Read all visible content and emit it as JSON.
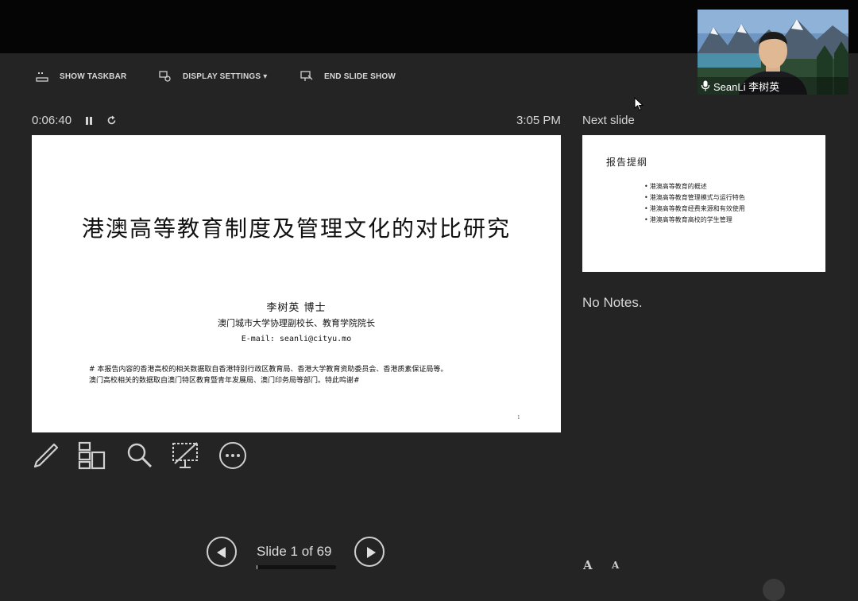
{
  "toolbar": {
    "show_taskbar": "SHOW TASKBAR",
    "display_settings": "DISPLAY SETTINGS ▾",
    "end_slide_show": "END SLIDE SHOW"
  },
  "status": {
    "timer": "0:06:40",
    "clock": "3:05 PM",
    "next_slide_label": "Next slide"
  },
  "current_slide": {
    "title": "港澳高等教育制度及管理文化的对比研究",
    "author": "李树英 博士",
    "role": "澳门城市大学协理副校长、教育学院院长",
    "email": "E-mail: seanli@cityu.mo",
    "note_line1": "# 本报告内容的香港高校的相关数据取自香港特别行政区教育局、香港大学教育资助委员会、香港质素保证局等。",
    "note_line2": "澳门高校相关的数据取自澳门特区教育暨青年发展局、澳门印务局等部门。特此鸣谢#",
    "page_number": "1"
  },
  "next_slide": {
    "title": "报告提纲",
    "items": [
      "港澳高等教育的概述",
      "港澳高等教育管理模式与运行特色",
      "港澳高等教育经费来源和有效使用",
      "港澳高等教育高校的学生管理"
    ]
  },
  "notes": {
    "text": "No Notes."
  },
  "tools": [
    "pen-icon",
    "slides-grid-icon",
    "zoom-icon",
    "black-screen-icon",
    "more-options-icon"
  ],
  "navigation": {
    "counter": "Slide 1 of 69",
    "current": 1,
    "total": 69,
    "progress_fraction": 0.0145
  },
  "font_controls": {
    "increase": "A",
    "decrease": "A"
  },
  "webcam": {
    "name": "SeanLi 李树英",
    "mic_icon": "microphone-icon"
  },
  "colors": {
    "background": "#242424",
    "topbar": "#050505",
    "text": "#dcdcdc"
  }
}
